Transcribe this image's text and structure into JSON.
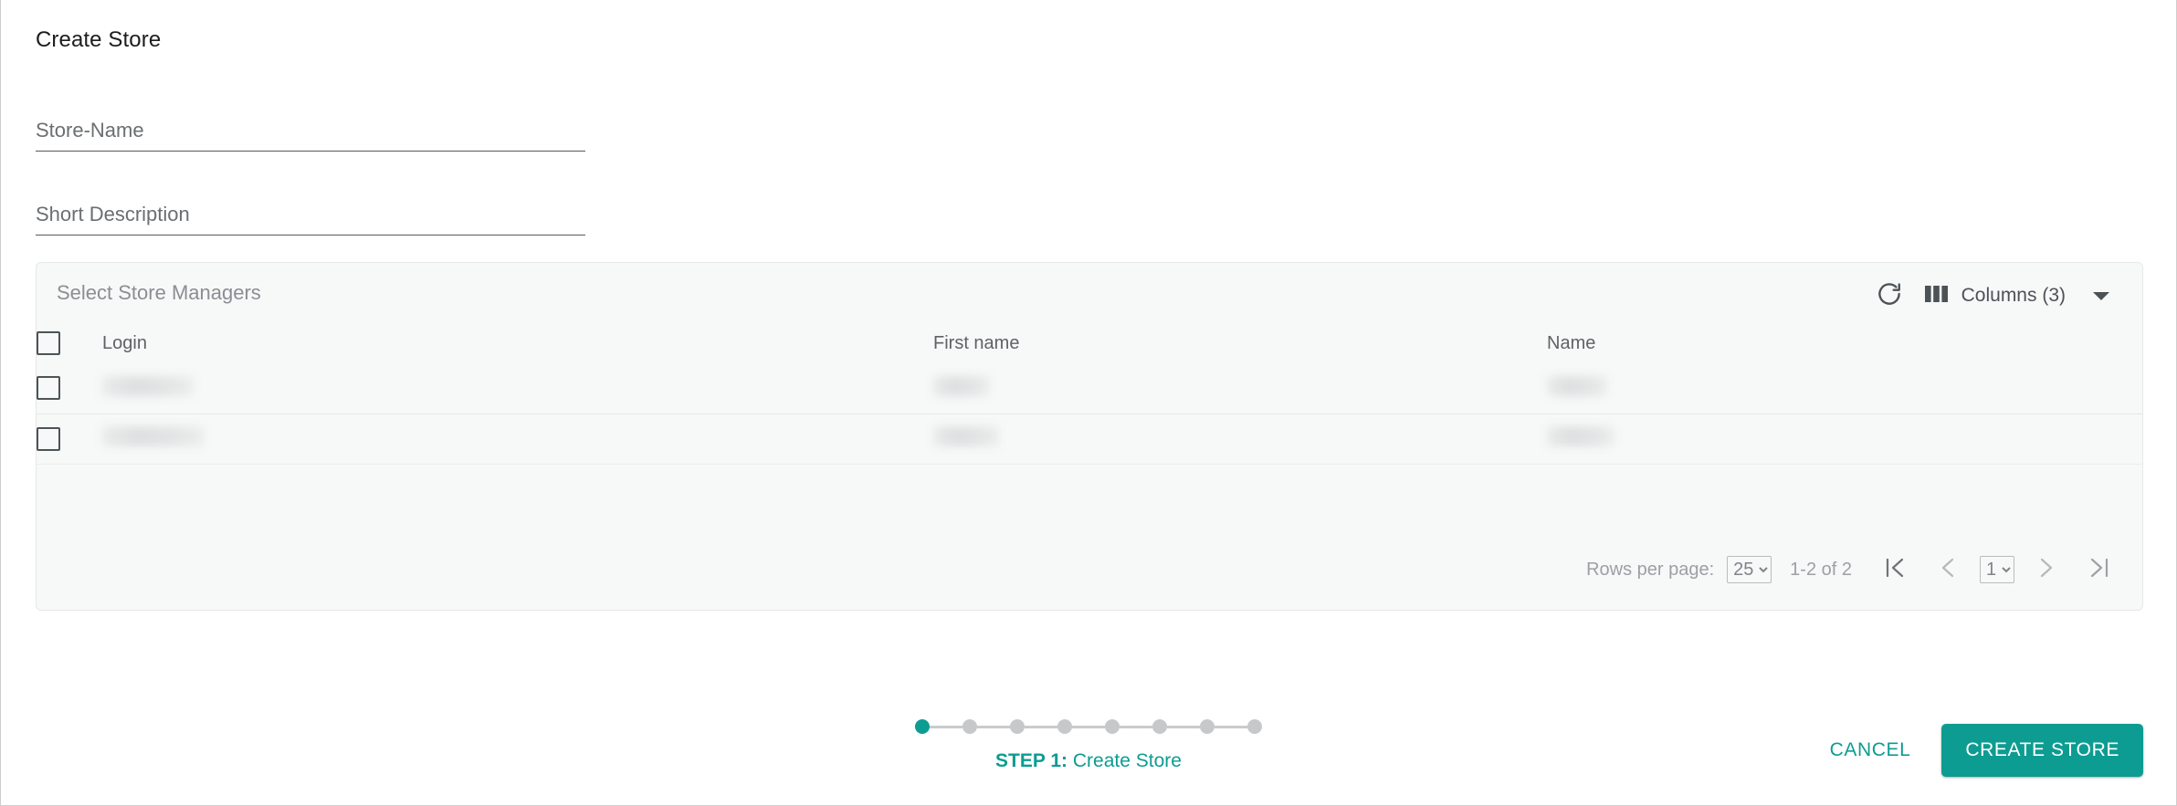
{
  "dialog": {
    "title": "Create Store"
  },
  "form": {
    "store_name": {
      "label": "Store-Name",
      "value": "",
      "placeholder": "Store-Name"
    },
    "short_description": {
      "label": "Short Description",
      "value": "",
      "placeholder": "Short Description"
    }
  },
  "managers": {
    "caption": "Select Store Managers",
    "toolbar": {
      "refresh_icon": "refresh-icon",
      "columns_icon": "columns-icon",
      "columns_label": "Columns (3)",
      "caret_icon": "chevron-down-icon"
    },
    "columns": [
      "Login",
      "First name",
      "Name"
    ],
    "rows": [
      {
        "login": "",
        "first_name": "",
        "name": "",
        "selected": false,
        "redacted": true
      },
      {
        "login": "",
        "first_name": "",
        "name": "",
        "selected": false,
        "redacted": true
      }
    ],
    "paginator": {
      "rows_per_page_label": "Rows per page:",
      "rows_per_page_value": "25",
      "rows_per_page_options": [
        "25"
      ],
      "range_label": "1-2 of 2",
      "first_page_icon": "first-page-icon",
      "previous_page_icon": "previous-page-icon",
      "page_value": "1",
      "page_options": [
        "1"
      ],
      "next_page_icon": "next-page-icon",
      "last_page_icon": "last-page-icon"
    }
  },
  "stepper": {
    "total_steps": 8,
    "active_step": 1,
    "step_prefix": "STEP 1:",
    "step_name": " Create Store"
  },
  "actions": {
    "cancel_label": "CANCEL",
    "submit_label": "CREATE STORE"
  },
  "colors": {
    "accent": "#0d9c92",
    "panel_bg": "#f7f8f8",
    "text_muted": "#8a8f93",
    "underline": "#555b5d"
  }
}
